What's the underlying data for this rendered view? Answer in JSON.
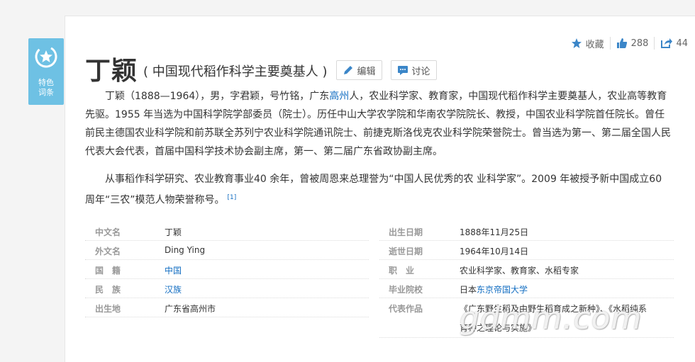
{
  "badge": {
    "line1": "特色",
    "line2": "词条",
    "color": "#6ec1e4"
  },
  "toolbar": {
    "favorite": "收藏",
    "likes": "288",
    "shares": "44"
  },
  "title": "丁颖",
  "subtitle": "( 中国现代稻作科学主要奠基人 )",
  "buttons": {
    "edit": "编辑",
    "discuss": "讨论"
  },
  "para1": {
    "before": "丁颖（1888—1964），男，字君颖，号竹铭，广东",
    "link": "高州",
    "after": "人，农业科学家、教育家，中国现代稻作科学主要奠基人，农业高等教育先驱。1955 年当选为中国科学院学部委员（院士）。历任中山大学农学院和华南农学院院长、教授，中国农业科学院首任院长。曾任前民主德国农业科学院和前苏联全苏列宁农业科学院通讯院士、前捷克斯洛伐克农业科学院荣誉院士。曾当选为第一、第二届全国人民代表大会代表，首届中国科学技术协会副主席，第一、第二届广东省政协副主席。"
  },
  "para2": {
    "text": "从事稻作科学研究、农业教育事业40 余年，曾被周恩来总理誉为“中国人民优秀的农 业科学家”。2009 年被授予新中国成立60 周年“三农”模范人物荣誉称号。",
    "ref": "[1]"
  },
  "info_left": [
    {
      "label": "中文名",
      "value": "丁颖"
    },
    {
      "label": "外文名",
      "value": "Ding Ying"
    },
    {
      "label": "国　籍",
      "value": "中国"
    },
    {
      "label": "民　族",
      "value": "汉族"
    },
    {
      "label": "出生地",
      "value": "广东省高州市"
    }
  ],
  "info_right": [
    {
      "label": "出生日期",
      "value": "1888年11月25日"
    },
    {
      "label": "逝世日期",
      "value": "1964年10月14日"
    },
    {
      "label": "职　业",
      "value": "农业科学家、教育家、水稻专家"
    },
    {
      "label": "毕业院校",
      "prefix": "日本",
      "link": "东京帝国大学"
    },
    {
      "label": "代表作品",
      "value": "《广东野生稻及由野生稻育成之新种》、《水稻纯系",
      "value2": "育种之理论与实施》"
    }
  ],
  "watermark": "gdmm.com",
  "colors": {
    "link": "#136ec2",
    "accent": "#3b86c8"
  }
}
